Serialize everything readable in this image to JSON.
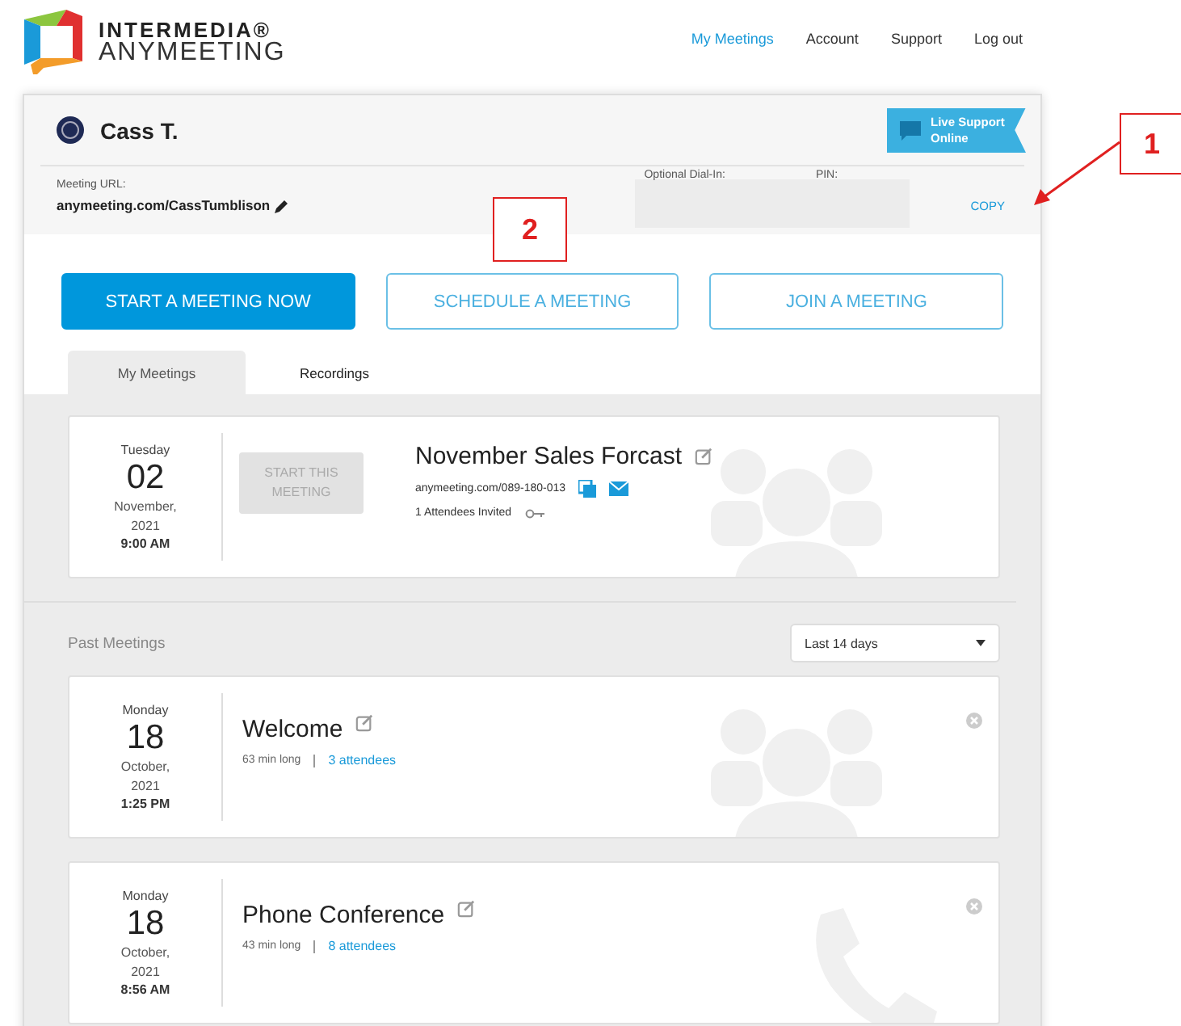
{
  "logo": {
    "line1": "INTERMEDIA®",
    "line2": "ANYMEETING"
  },
  "nav": [
    {
      "label": "My Meetings",
      "selected": true
    },
    {
      "label": "Account",
      "selected": false
    },
    {
      "label": "Support",
      "selected": false
    },
    {
      "label": "Log out",
      "selected": false
    }
  ],
  "user": {
    "name": "Cass T."
  },
  "live_support": {
    "line1": "Live Support",
    "line2": "Online"
  },
  "meeting_url": {
    "label": "Meeting URL:",
    "value": "anymeeting.com/CassTumblison"
  },
  "dial_in": {
    "label": "Optional Dial-In:",
    "pin_label": "PIN:",
    "copy": "COPY"
  },
  "actions": [
    {
      "label": "START A MEETING NOW",
      "kind": "primary"
    },
    {
      "label": "SCHEDULE A MEETING",
      "kind": "outline"
    },
    {
      "label": "JOIN A MEETING",
      "kind": "outline"
    }
  ],
  "tabs": [
    {
      "label": "My Meetings",
      "selected": true
    },
    {
      "label": "Recordings",
      "selected": false
    }
  ],
  "upcoming": {
    "weekday": "Tuesday",
    "day": "02",
    "month": "November,",
    "year": "2021",
    "time": "9:00 AM",
    "start_button": "START THIS MEETING",
    "start_disabled": true,
    "title": "November Sales Forcast",
    "link": "anymeeting.com/089-180-013",
    "invited": "1 Attendees Invited"
  },
  "past": {
    "label": "Past Meetings",
    "filter": "Last 14 days",
    "meetings": [
      {
        "kind": "group",
        "weekday": "Monday",
        "day": "18",
        "month": "October,",
        "year": "2021",
        "time": "1:25 PM",
        "title": "Welcome",
        "duration": "63 min long",
        "attendees": "3 attendees"
      },
      {
        "kind": "phone",
        "weekday": "Monday",
        "day": "18",
        "month": "October,",
        "year": "2021",
        "time": "8:56 AM",
        "title": "Phone Conference",
        "duration": "43 min long",
        "attendees": "8 attendees"
      }
    ]
  },
  "callouts": [
    "1",
    "2"
  ]
}
